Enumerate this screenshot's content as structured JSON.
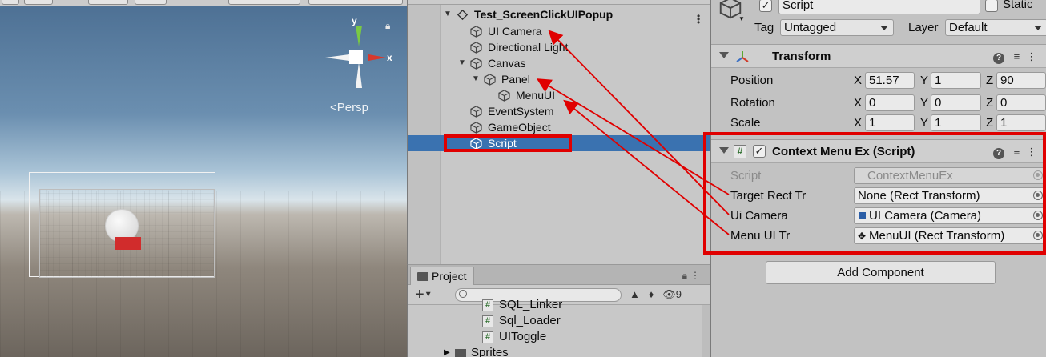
{
  "scene": {
    "camera_mode": "Persp",
    "gizmo_axes": {
      "y": "y",
      "x": "x"
    },
    "colors": {
      "y_axis": "#7ac943",
      "x_axis": "#d8382b",
      "object_red": "#d12c2c"
    }
  },
  "hierarchy": {
    "scene_name": "Test_ScreenClickUIPopup",
    "items": [
      {
        "label": "UI Camera"
      },
      {
        "label": "Directional Light"
      },
      {
        "label": "Canvas"
      },
      {
        "label": "Panel"
      },
      {
        "label": "MenuUI"
      },
      {
        "label": "EventSystem"
      },
      {
        "label": "GameObject"
      },
      {
        "label": "Script"
      }
    ],
    "selected_color": "#3a72b0"
  },
  "project": {
    "tab_label": "Project",
    "search_placeholder": "",
    "hidden_count": "9",
    "assets": [
      {
        "label": "SQL_Linker"
      },
      {
        "label": "Sql_Loader"
      },
      {
        "label": "UIToggle"
      }
    ],
    "folder_label": "Sprites"
  },
  "inspector": {
    "object_name": "Script",
    "static_label": "Static",
    "tag_label": "Tag",
    "tag_value": "Untagged",
    "layer_label": "Layer",
    "layer_value": "Default",
    "transform": {
      "title": "Transform",
      "position_label": "Position",
      "rotation_label": "Rotation",
      "scale_label": "Scale",
      "axis_x": "X",
      "axis_y": "Y",
      "axis_z": "Z",
      "position": {
        "x": "51.57",
        "y": "1",
        "z": "90"
      },
      "rotation": {
        "x": "0",
        "y": "0",
        "z": "0"
      },
      "scale": {
        "x": "1",
        "y": "1",
        "z": "1"
      }
    },
    "component": {
      "title": "Context Menu Ex (Script)",
      "script_label": "Script",
      "script_value": "ContextMenuEx",
      "fields": [
        {
          "label": "Target Rect Tr",
          "value": "None (Rect Transform)"
        },
        {
          "label": "Ui Camera",
          "value": "UI Camera (Camera)"
        },
        {
          "label": "Menu UI Tr",
          "value": "MenuUI (Rect Transform)"
        }
      ]
    },
    "add_component_label": "Add Component"
  },
  "annotation_color": "#e00000"
}
